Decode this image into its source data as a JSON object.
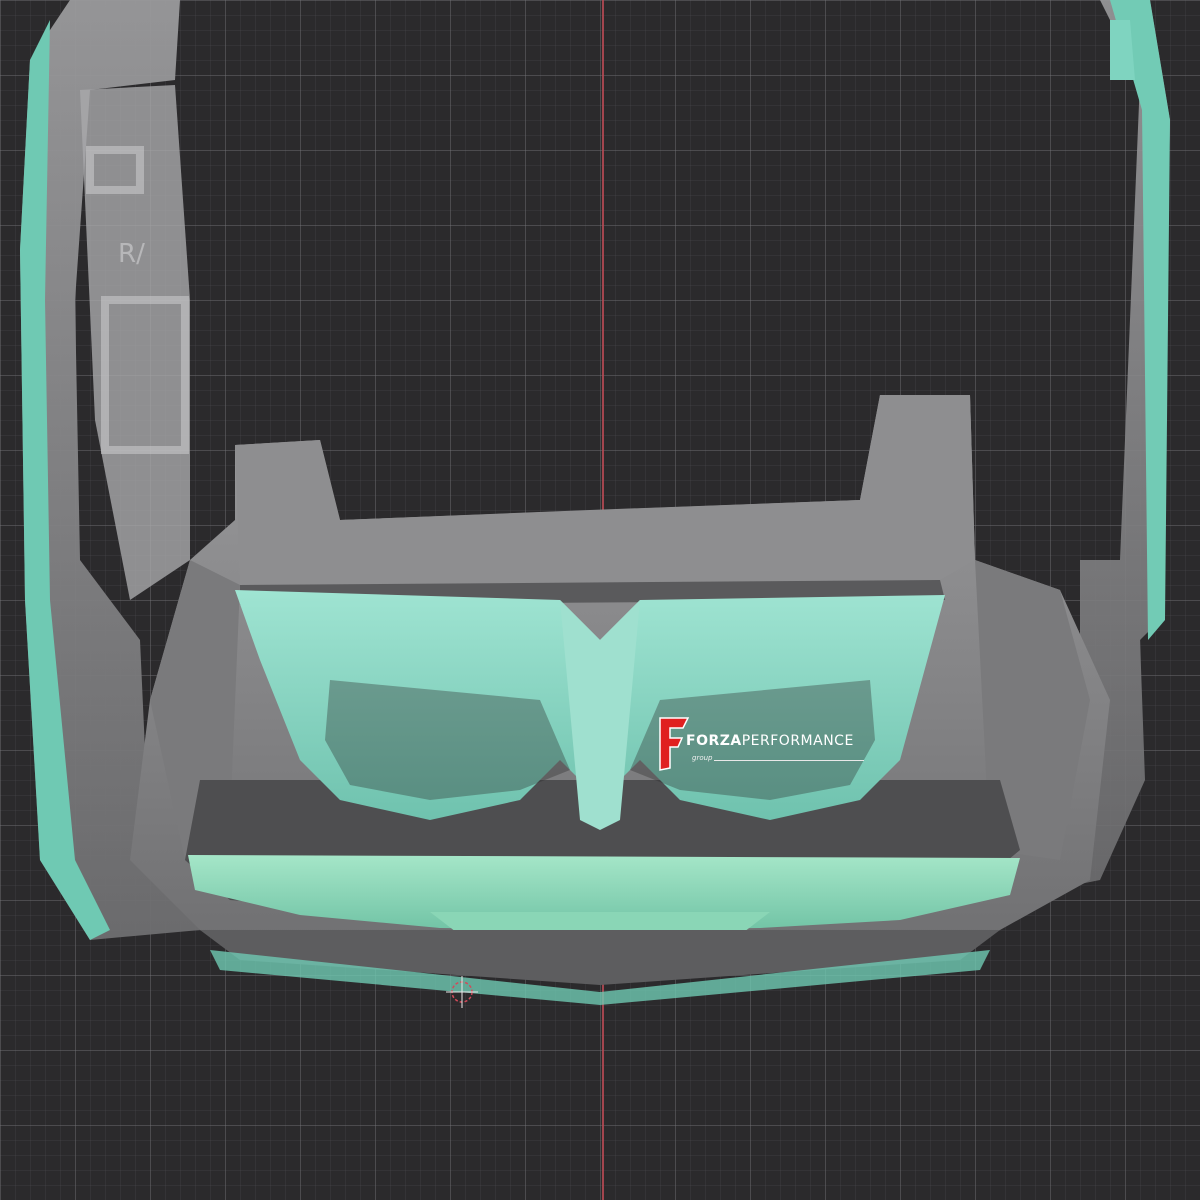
{
  "viewport": {
    "background": "#2b2a2c",
    "grid_color": "#78787c",
    "axis_color": "#b84a55"
  },
  "model": {
    "part_color": "#7fd4c0",
    "body_color": "#8c8c8e",
    "gizmo_color": "#d24a5a"
  },
  "watermark": {
    "brand_word_1": "FORZA",
    "brand_word_2": "PERFORMANCE",
    "brand_sub": "group",
    "mark_color": "#e02020"
  },
  "gizmo": {
    "icon": "origin-gizmo-icon"
  }
}
